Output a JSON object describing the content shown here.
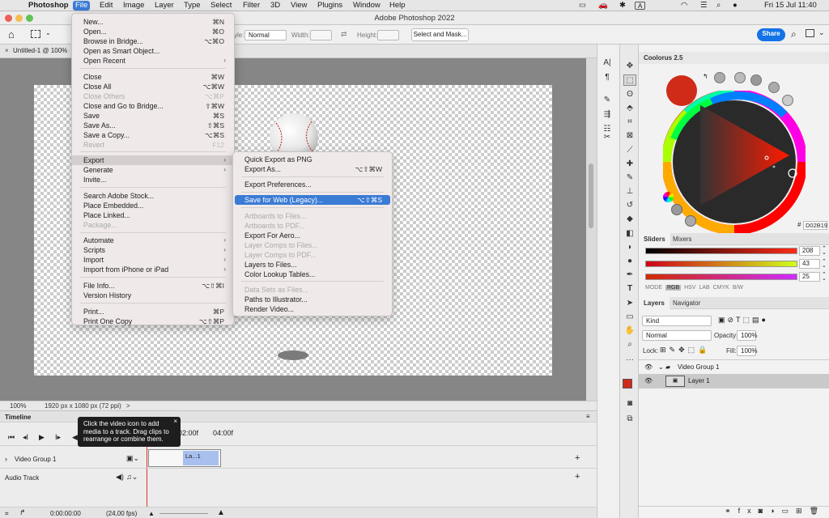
{
  "menubar": {
    "apple": "",
    "items": [
      "Photoshop",
      "File",
      "Edit",
      "Image",
      "Layer",
      "Type",
      "Select",
      "Filter",
      "3D",
      "View",
      "Plugins",
      "Window",
      "Help"
    ],
    "clock": "Fri 15 Jul  11:40",
    "status_a": "A"
  },
  "window": {
    "title": "Adobe Photoshop 2022"
  },
  "options": {
    "style_label": "yle:",
    "style_value": "Normal",
    "width_label": "Width:",
    "height_label": "Height:",
    "select_mask": "Select and Mask...",
    "share": "Share"
  },
  "doc_tab": {
    "label": "Untitled-1 @ 100%"
  },
  "status": {
    "zoom": "100%",
    "size": "1920 px x 1080 px (72 ppi)",
    "arrow": ">"
  },
  "file_menu": [
    {
      "label": "New...",
      "sc": "⌘N"
    },
    {
      "label": "Open...",
      "sc": "⌘O"
    },
    {
      "label": "Browse in Bridge...",
      "sc": "⌥⌘O"
    },
    {
      "label": "Open as Smart Object...",
      "sc": ""
    },
    {
      "label": "Open Recent",
      "sc": "",
      "sub": true
    },
    {
      "label": "Close",
      "sc": "⌘W"
    },
    {
      "label": "Close All",
      "sc": "⌥⌘W"
    },
    {
      "label": "Close Others",
      "sc": "⌥⌘P",
      "dis": true
    },
    {
      "label": "Close and Go to Bridge...",
      "sc": "⇧⌘W"
    },
    {
      "label": "Save",
      "sc": "⌘S"
    },
    {
      "label": "Save As...",
      "sc": "⇧⌘S"
    },
    {
      "label": "Save a Copy...",
      "sc": "⌥⌘S"
    },
    {
      "label": "Revert",
      "sc": "F12",
      "dis": true
    },
    {
      "label": "Export",
      "sc": "",
      "sub": true,
      "hl": true
    },
    {
      "label": "Generate",
      "sc": "",
      "sub": true
    },
    {
      "label": "Invite...",
      "sc": ""
    },
    {
      "label": "Search Adobe Stock...",
      "sc": ""
    },
    {
      "label": "Place Embedded...",
      "sc": ""
    },
    {
      "label": "Place Linked...",
      "sc": ""
    },
    {
      "label": "Package...",
      "sc": "",
      "dis": true
    },
    {
      "label": "Automate",
      "sc": "",
      "sub": true
    },
    {
      "label": "Scripts",
      "sc": "",
      "sub": true
    },
    {
      "label": "Import",
      "sc": "",
      "sub": true
    },
    {
      "label": "Import from iPhone or iPad",
      "sc": "",
      "sub": true
    },
    {
      "label": "File Info...",
      "sc": "⌥⇧⌘I"
    },
    {
      "label": "Version History",
      "sc": ""
    },
    {
      "label": "Print...",
      "sc": "⌘P"
    },
    {
      "label": "Print One Copy",
      "sc": "⌥⇧⌘P"
    }
  ],
  "export_menu": [
    {
      "label": "Quick Export as PNG",
      "sc": ""
    },
    {
      "label": "Export As...",
      "sc": "⌥⇧⌘W"
    },
    {
      "label": "Export Preferences...",
      "sc": ""
    },
    {
      "label": "Save for Web (Legacy)...",
      "sc": "⌥⇧⌘S",
      "sel": true
    },
    {
      "label": "Artboards to Files...",
      "sc": "",
      "dis": true
    },
    {
      "label": "Artboards to PDF...",
      "sc": "",
      "dis": true
    },
    {
      "label": "Export For Aero...",
      "sc": ""
    },
    {
      "label": "Layer Comps to Files...",
      "sc": "",
      "dis": true
    },
    {
      "label": "Layer Comps to PDF...",
      "sc": "",
      "dis": true
    },
    {
      "label": "Layers to Files...",
      "sc": ""
    },
    {
      "label": "Color Lookup Tables...",
      "sc": ""
    },
    {
      "label": "Data Sets as Files...",
      "sc": "",
      "dis": true
    },
    {
      "label": "Paths to Illustrator...",
      "sc": ""
    },
    {
      "label": "Render Video...",
      "sc": ""
    }
  ],
  "timeline": {
    "title": "Timeline",
    "time1": "02:00f",
    "time2": "04:00f",
    "clip": "La...1",
    "video_group": "Video Group 1",
    "audio_track": "Audio Track",
    "timecode": "0:00:00:00",
    "fps": "(24,00 fps)"
  },
  "tooltip": {
    "text": "Click the video icon to add media to a track. Drag clips to rearrange or combine them."
  },
  "coolorus": {
    "title": "Coolorus 2.5",
    "hex_label": "#",
    "hex": "D02B19",
    "color": "#D02B19"
  },
  "sliders": {
    "tabs": [
      "Sliders",
      "Mixers"
    ],
    "r": "208",
    "g": "43",
    "b": "25",
    "modes": [
      "MODE",
      "RGB",
      "HSV",
      "LAB",
      "CMYK",
      "B/W"
    ]
  },
  "layers": {
    "tabs": [
      "Layers",
      "Navigator"
    ],
    "kind": "Kind",
    "blend": "Normal",
    "opacity_label": "Opacity:",
    "opacity": "100%",
    "lock_label": "Lock:",
    "fill_label": "Fill:",
    "fill": "100%",
    "rows": [
      "Video Group 1",
      "Layer 1"
    ]
  },
  "colors": {
    "fg": "#D02B19",
    "accent": "#3a7bd5"
  }
}
